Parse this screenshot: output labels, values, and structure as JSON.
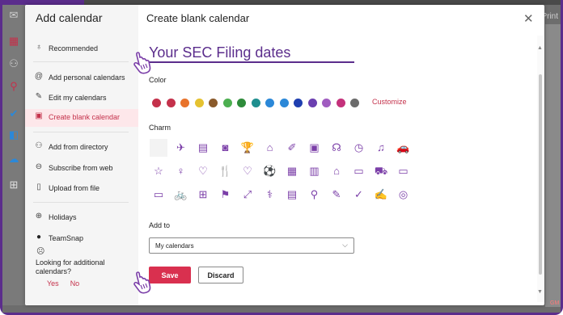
{
  "window": {
    "print_label": "Print",
    "badge": "GM"
  },
  "sidebar": {
    "title": "Add calendar",
    "items": [
      {
        "label": "Recommended",
        "icon": "lightbulb-icon"
      },
      {
        "label": "Add personal calendars",
        "icon": "at-icon"
      },
      {
        "label": "Edit my calendars",
        "icon": "edit-icon"
      },
      {
        "label": "Create blank calendar",
        "icon": "calendar-icon",
        "active": true
      },
      {
        "label": "Add from directory",
        "icon": "people-icon"
      },
      {
        "label": "Subscribe from web",
        "icon": "globe-icon"
      },
      {
        "label": "Upload from file",
        "icon": "document-icon"
      },
      {
        "label": "Holidays",
        "icon": "globe-icon"
      },
      {
        "label": "TeamSnap",
        "icon": "teamsnap-icon"
      }
    ],
    "ask_text": "Looking for additional calendars?",
    "ask_yes": "Yes",
    "ask_no": "No"
  },
  "main": {
    "title": "Create blank calendar",
    "name_value": "Your SEC Filing dates",
    "color_label": "Color",
    "colors": [
      "#c4314b",
      "#c4314b",
      "#e8732b",
      "#e5c230",
      "#8a5a2b",
      "#4caf50",
      "#2e8b3a",
      "#1f8f8f",
      "#2b88d8",
      "#2b88d8",
      "#1f3fb0",
      "#6b3fb0",
      "#a05cc0",
      "#c4317b",
      "#6b6b6b"
    ],
    "customize_label": "Customize",
    "charm_label": "Charm",
    "charms": [
      [
        "",
        "✈",
        "▤",
        "◙",
        "🏆",
        "⌂",
        "✐",
        "▣",
        "☊",
        "◷",
        "♫",
        "🚗"
      ],
      [
        "☆",
        "♀",
        "♡",
        "🍴",
        "♡",
        "⚽",
        "▦",
        "▥",
        "⌂",
        "▭",
        "⛟",
        "▭"
      ],
      [
        "▭",
        "🚲",
        "⊞",
        "⚑",
        "⤢",
        "⚕",
        "▤",
        "⚲",
        "✎",
        "✓",
        "✍",
        "◎"
      ]
    ],
    "add_to_label": "Add to",
    "add_to_value": "My calendars",
    "save_label": "Save",
    "discard_label": "Discard"
  }
}
